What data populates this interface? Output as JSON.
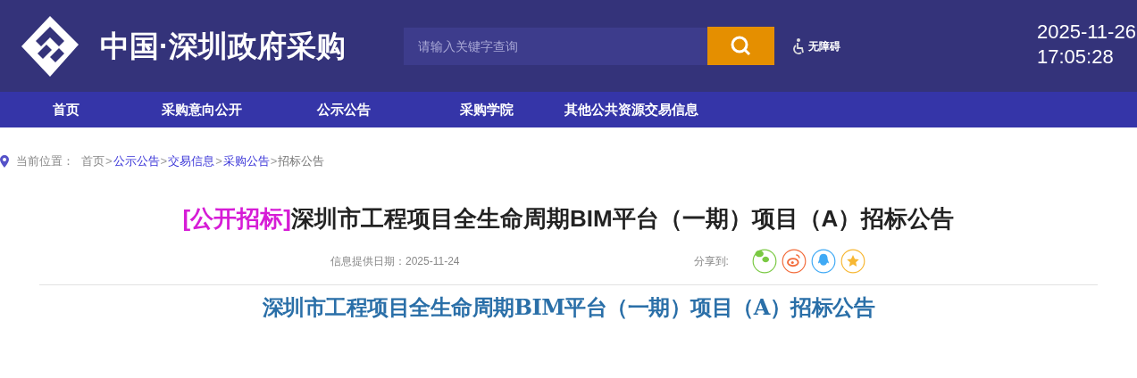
{
  "header": {
    "site_title": "中国·深圳政府采购",
    "search": {
      "placeholder": "请输入关键字查询"
    },
    "accessibility": "无障碍",
    "date": "2025-11-26",
    "time": "17:05:28"
  },
  "nav": [
    {
      "label": "首页"
    },
    {
      "label": "采购意向公开"
    },
    {
      "label": "公示公告"
    },
    {
      "label": "采购学院"
    },
    {
      "label": "其他公共资源交易信息"
    }
  ],
  "breadcrumb": {
    "label": "当前位置：",
    "items": [
      {
        "text": "首页",
        "kind": "plain",
        "separator": ">"
      },
      {
        "text": "公示公告",
        "kind": "link",
        "separator": ">"
      },
      {
        "text": "交易信息",
        "kind": "link",
        "separator": ">"
      },
      {
        "text": "采购公告",
        "kind": "link",
        "separator": ">"
      },
      {
        "text": "招标公告",
        "kind": "current"
      }
    ]
  },
  "article": {
    "tag": "[公开招标]",
    "title": "深圳市工程项目全生命周期BIM平台（一期）项目（A）招标公告",
    "date_label": "信息提供日期：2025-11-24",
    "share_label": "分享到:",
    "share": [
      {
        "kind": "wechat",
        "color": "#7ac943"
      },
      {
        "kind": "weibo",
        "color": "#f26b3a"
      },
      {
        "kind": "qq",
        "color": "#3fa9f5"
      },
      {
        "kind": "favorite",
        "color": "#f7b733"
      }
    ],
    "subtitle": "深圳市工程项目全生命周期BIM平台（一期）项目（A）招标公告"
  }
}
